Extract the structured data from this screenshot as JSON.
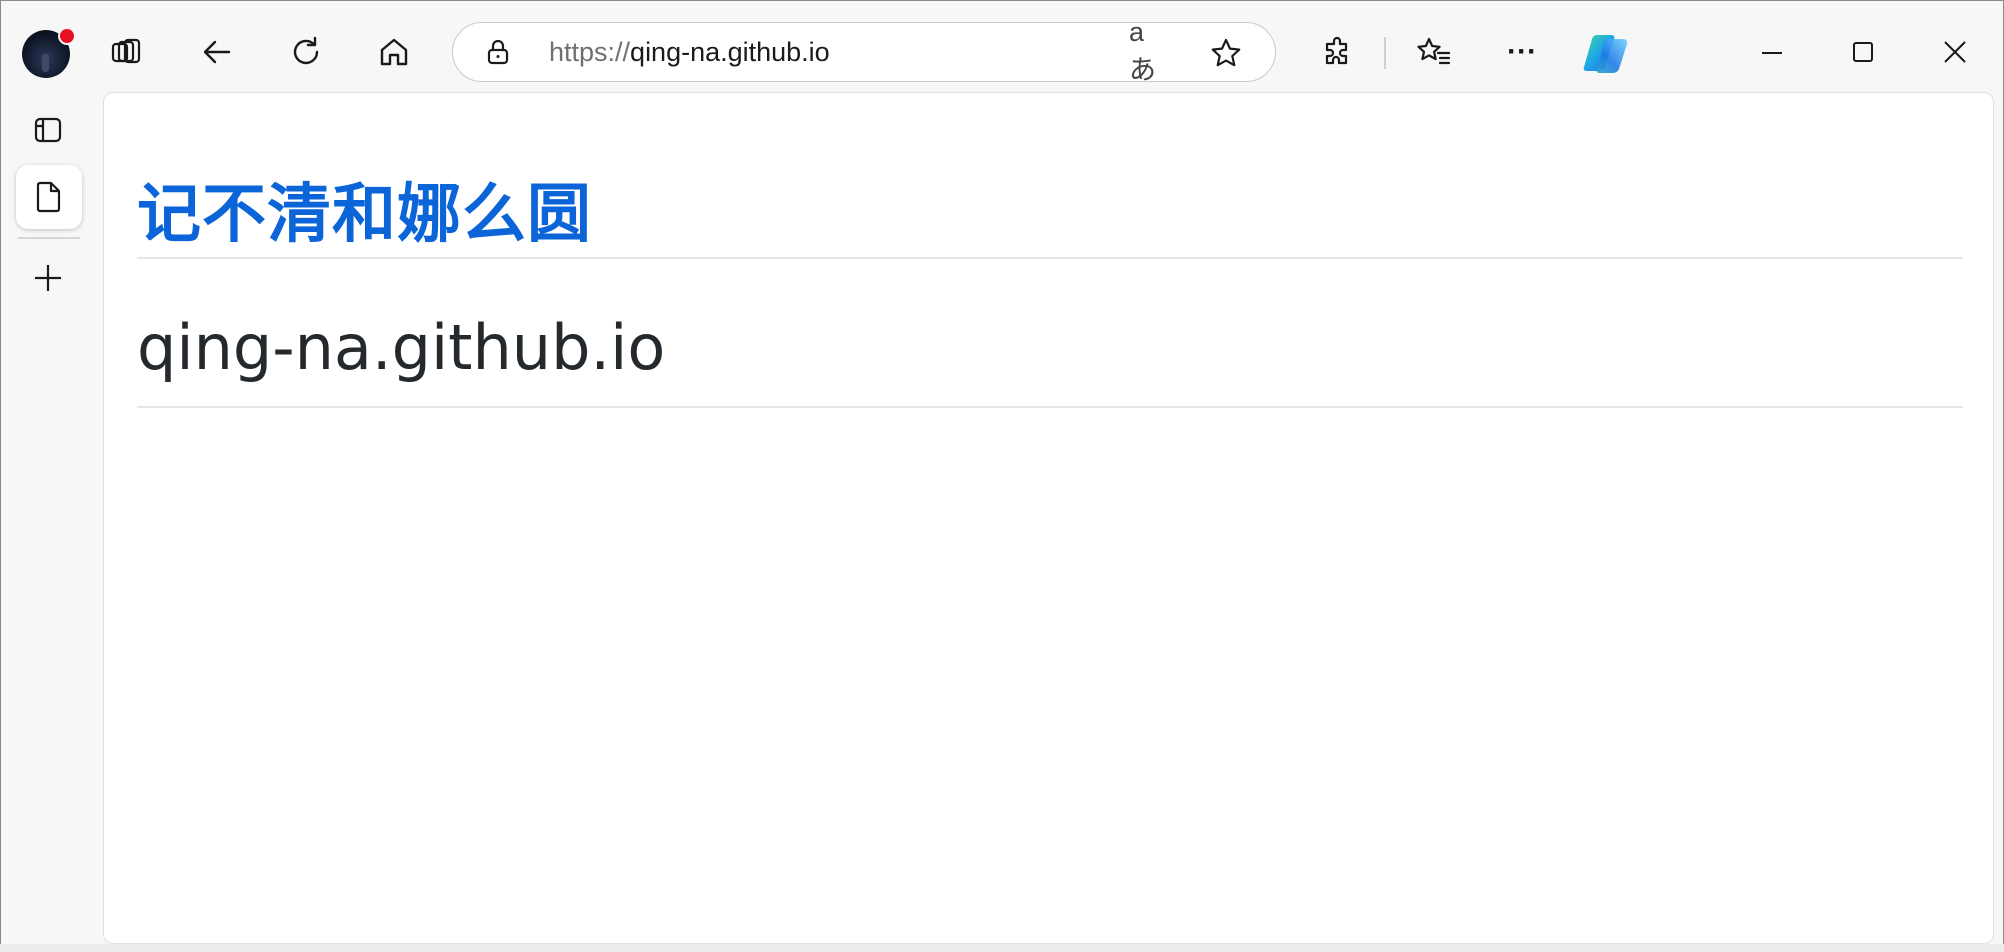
{
  "browser": {
    "url_scheme": "https://",
    "url_host": "qing-na.github.io",
    "icons": [
      "profile-avatar",
      "workspaces-icon",
      "back-icon",
      "refresh-icon",
      "home-icon",
      "lock-icon",
      "read-aloud-translate-icon",
      "favorite-star-icon",
      "extensions-icon",
      "favorites-icon",
      "more-icon",
      "copilot-icon",
      "minimize-icon",
      "maximize-icon",
      "close-icon"
    ],
    "translate_glyph": "aあ",
    "more_glyph": "···"
  },
  "sidebar": {
    "icons": [
      "tab-actions-icon",
      "page-tab-icon",
      "new-tab-icon"
    ]
  },
  "page": {
    "title": "记不清和娜么圆",
    "heading": "qing-na.github.io"
  },
  "colors": {
    "accent": "#0b64d8",
    "heading_text": "#24292e",
    "frame": "#f7f7f7"
  }
}
